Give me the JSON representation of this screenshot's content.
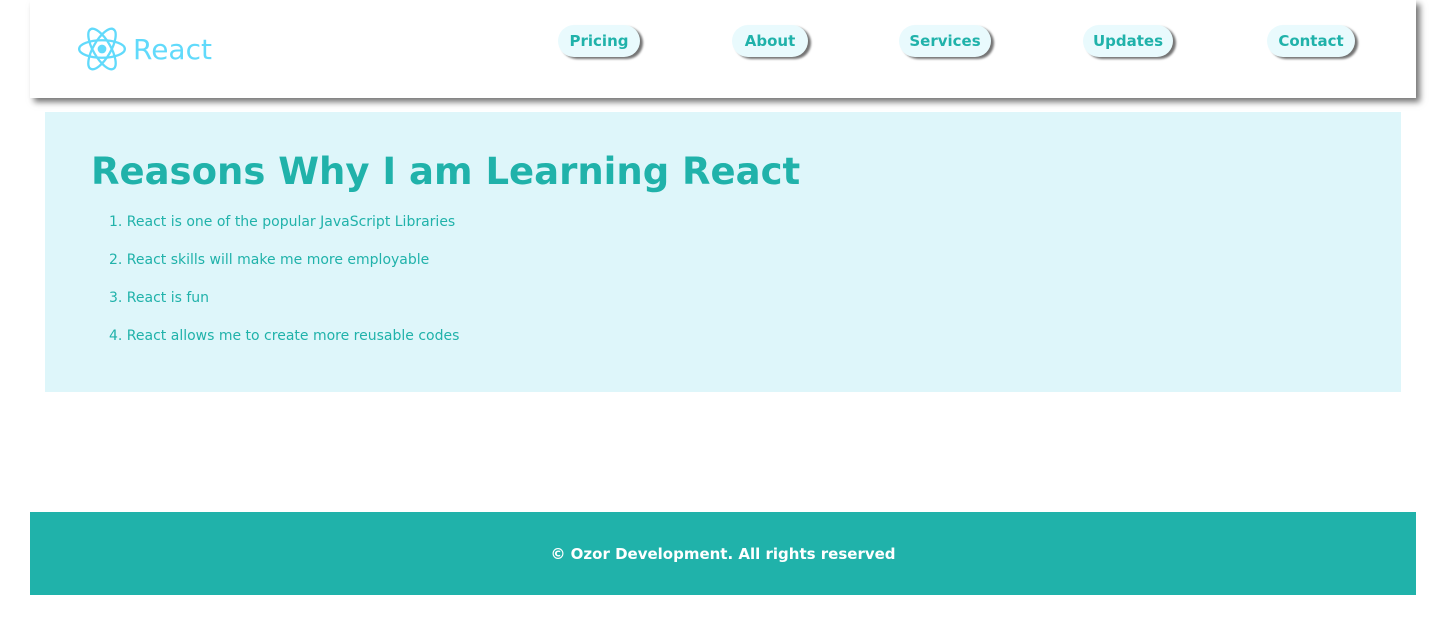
{
  "colors": {
    "accent": "#20b2aa",
    "react_logo": "#61dafb",
    "hero_bg": "#def6fa",
    "nav_button_bg": "#e9fafd"
  },
  "header": {
    "logo_icon": "react-atom-icon",
    "brand": "React",
    "nav": [
      "Pricing",
      "About",
      "Services",
      "Updates",
      "Contact"
    ]
  },
  "main": {
    "title": "Reasons Why I am Learning React",
    "reasons": [
      "1. React is one of the popular JavaScript Libraries",
      "2. React skills will make me more employable",
      "3. React is fun",
      "4. React allows me to create more reusable codes"
    ]
  },
  "footer": {
    "text": "© Ozor Development. All rights reserved"
  }
}
